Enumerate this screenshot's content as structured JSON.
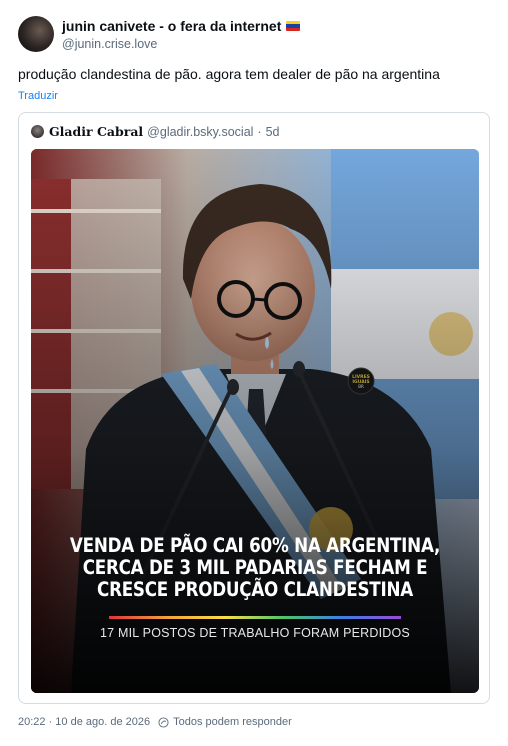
{
  "author": {
    "display_name": "junin canivete - o fera da internet",
    "handle": "@junin.crise.love",
    "flag_icon": "venezuela-flag-icon",
    "flag_colors": [
      "#f7d117",
      "#1a3fa6",
      "#d7261e"
    ]
  },
  "post": {
    "text": "produção clandestina de pão. agora tem dealer de pão na argentina",
    "translate_label": "Traduzir"
  },
  "quote": {
    "author_name": "Gladir Cabral",
    "author_handle": "@gladir.bsky.social",
    "separator": "·",
    "age": "5d",
    "image": {
      "headline_lines": [
        "VENDA DE PÃO CAI 60% NA ARGENTINA,",
        "CERCA DE 3 MIL PADARIAS FECHAM E",
        "CRESCE PRODUÇÃO CLANDESTINA"
      ],
      "subline": "17 MIL POSTOS DE TRABALHO FORAM PERDIDOS",
      "pin_text": [
        "LIVRES",
        "IGUAIS",
        "BR"
      ]
    }
  },
  "footer": {
    "timestamp": "20:22 · 10 de ago. de 2026",
    "reply_setting": "Todos podem responder"
  },
  "colors": {
    "link": "#1083fe",
    "secondary_text": "#5b6b7c",
    "border": "#d4dbe2"
  }
}
